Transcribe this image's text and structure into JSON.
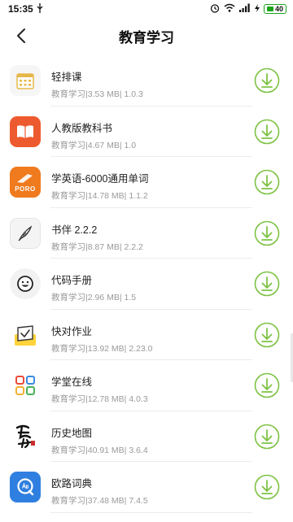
{
  "status": {
    "time": "15:35",
    "battery": "40"
  },
  "header": {
    "title": "教育学习"
  },
  "apps": [
    {
      "name": "轻排课",
      "meta": "教育学习|3.53 MB| 1.0.3",
      "icon": "timetable-icon"
    },
    {
      "name": "人教版教科书",
      "meta": "教育学习|4.67 MB| 1.0",
      "icon": "textbook-icon"
    },
    {
      "name": "学英语-6000通用单词",
      "meta": "教育学习|14.78 MB| 1.1.2",
      "icon": "poro-icon",
      "icon_text": "PORO"
    },
    {
      "name": "书伴 2.2.2",
      "meta": "教育学习|8.87 MB| 2.2.2",
      "icon": "quill-icon"
    },
    {
      "name": "代码手册",
      "meta": "教育学习|2.96 MB| 1.5",
      "icon": "smiley-icon"
    },
    {
      "name": "快对作业",
      "meta": "教育学习|13.92 MB| 2.23.0",
      "icon": "homework-icon"
    },
    {
      "name": "学堂在线",
      "meta": "教育学习|12.78 MB| 4.0.3",
      "icon": "squares-icon"
    },
    {
      "name": "历史地图",
      "meta": "教育学习|40.91 MB| 3.6.4",
      "icon": "history-map-icon"
    },
    {
      "name": "欧路词典",
      "meta": "教育学习|37.48 MB| 7.4.5",
      "icon": "dictionary-icon"
    }
  ],
  "colors": {
    "download_green": "#7dc243"
  }
}
